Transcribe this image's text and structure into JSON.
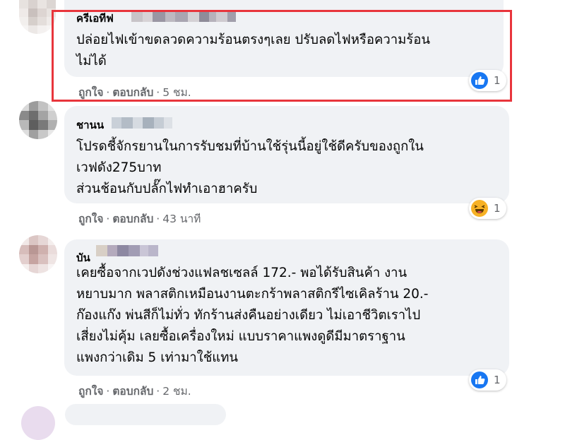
{
  "comments": [
    {
      "author": "ครีเอทีฟ",
      "text": "ปล่อยไฟเข้าขดลวดความร้อนตรงๆเลย ปรับลดไฟหรือความร้อน\nไม่ได้",
      "like_label": "ถูกใจ",
      "reply_label": "ตอบกลับ",
      "time": "5 ชม.",
      "reaction_icon": "like-icon",
      "reaction_count": "1",
      "highlighted": true
    },
    {
      "author": "ชานน",
      "text": "โปรดชี้จักรยานในการรับชมที่บ้านใช้รุ่นนี้อยู่ใช้ดีครับของถูกใน\nเวฟดัง275บาท\nส่วนช้อนกับปลั๊กไฟทำเอาฮาครับ",
      "like_label": "ถูกใจ",
      "reply_label": "ตอบกลับ",
      "time": "43 นาที",
      "reaction_icon": "haha-icon",
      "reaction_count": "1"
    },
    {
      "author": "บัน",
      "text": "เคยซื้อจากเวปดังช่วงแฟลชเซลล์ 172.- พอได้รับสินค้า งาน\nหยาบมาก พลาสติกเหมือนงานตะกร้าพลาสติกรีไซเคิลร้าน 20.-\nก๊องแก๊ง พ่นสีก็ไม่ทั่ว ทักร้านส่งคืนอย่างเดียว ไม่เอาชีวิตเราไป\nเสี่ยงไม่คุ้ม เลยซื้อเครื่องใหม่ แบบราคาแพงดูดีมีมาตราฐาน\nแพงกว่าเดิม 5 เท่ามาใช้แทน",
      "like_label": "ถูกใจ",
      "reply_label": "ตอบกลับ",
      "time": "2 ชม.",
      "reaction_icon": "like-icon",
      "reaction_count": "1"
    }
  ],
  "colors": {
    "highlight_border": "#e8353c",
    "bubble_bg": "#f0f2f5",
    "meta_text": "#65676b",
    "like_blue": "#1877f2",
    "haha_yellow": "#f7b125"
  }
}
